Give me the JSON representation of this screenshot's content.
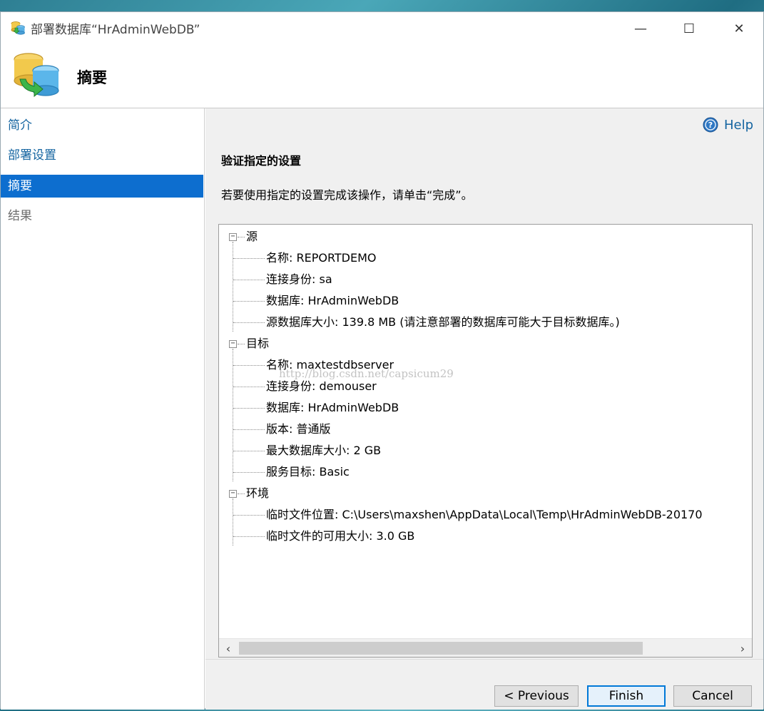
{
  "window": {
    "title": "部署数据库“HrAdminWebDB”",
    "minimize_glyph": "—",
    "maximize_glyph": "☐",
    "close_glyph": "✕"
  },
  "header": {
    "title": "摘要"
  },
  "sidebar": {
    "items": [
      {
        "label": "简介",
        "state": "link"
      },
      {
        "label": "部署设置",
        "state": "link"
      },
      {
        "label": "摘要",
        "state": "active"
      },
      {
        "label": "结果",
        "state": "disabled"
      }
    ]
  },
  "content": {
    "help_label": "Help",
    "section_title": "验证指定的设置",
    "instruction": "若要使用指定的设置完成该操作，请单击“完成”。"
  },
  "tree": {
    "groups": [
      {
        "label": "源",
        "expander": "−",
        "items": [
          "名称: REPORTDEMO",
          "连接身份: sa",
          "数据库: HrAdminWebDB",
          "源数据库大小: 139.8 MB (请注意部署的数据库可能大于目标数据库。)"
        ]
      },
      {
        "label": "目标",
        "expander": "−",
        "items": [
          "名称: maxtestdbserver",
          "连接身份: demouser",
          "数据库: HrAdminWebDB",
          "版本: 普通版",
          "最大数据库大小: 2 GB",
          "服务目标: Basic"
        ]
      },
      {
        "label": "环境",
        "expander": "−",
        "items": [
          "临时文件位置: C:\\Users\\maxshen\\AppData\\Local\\Temp\\HrAdminWebDB-20170",
          "临时文件的可用大小: 3.0 GB"
        ]
      }
    ]
  },
  "scrollbar": {
    "left_arrow": "‹",
    "right_arrow": "›"
  },
  "buttons": {
    "previous": "< Previous",
    "finish": "Finish",
    "cancel": "Cancel"
  },
  "watermark": "http://blog.csdn.net/capsicum29",
  "colors": {
    "accent": "#0d6ecf",
    "link": "#1464a0",
    "finish_border": "#0078d7"
  },
  "icons": {
    "app": "database-deploy-icon",
    "header": "database-deploy-large-icon",
    "help": "help-circle-icon"
  }
}
